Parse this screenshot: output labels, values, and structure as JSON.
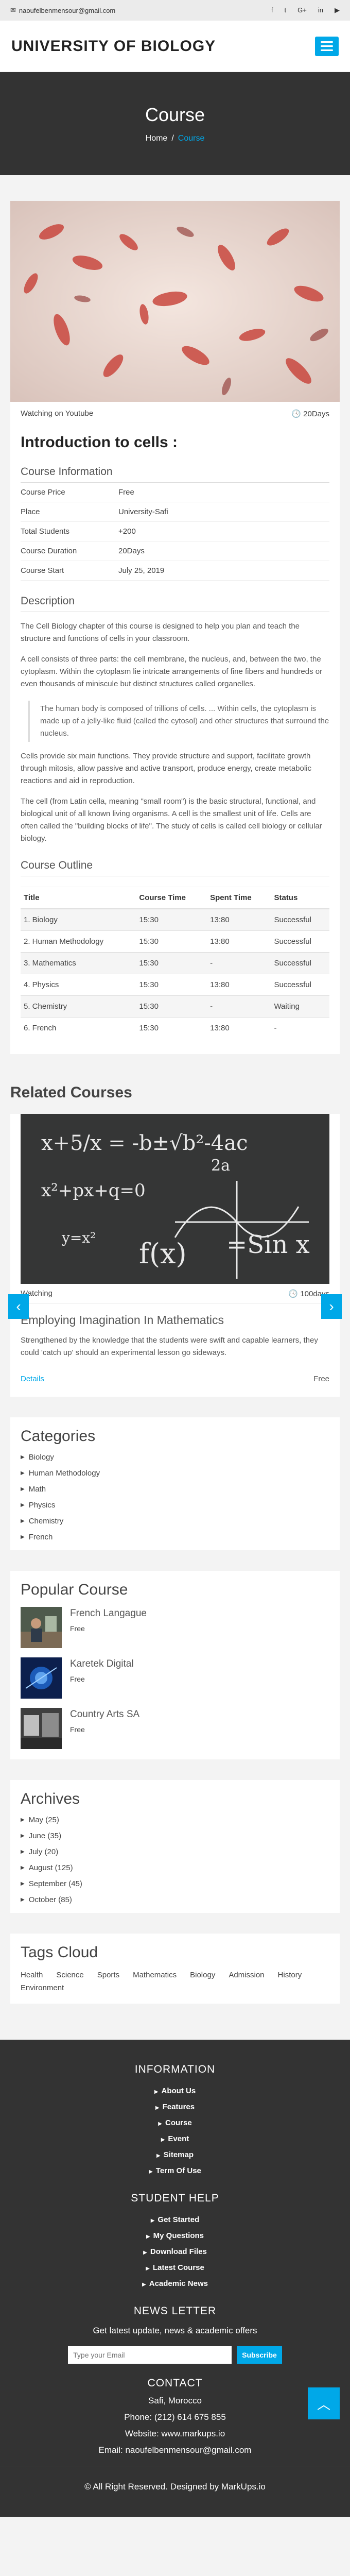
{
  "topbar": {
    "email": "naoufelbenmensour@gmail.com",
    "social": [
      "f",
      "t",
      "G+",
      "in",
      "▶"
    ]
  },
  "header": {
    "logo": "UNIVERSITY OF BIOLOGY"
  },
  "hero": {
    "title": "Course",
    "breadcrumb": [
      "Home",
      "/",
      "Course"
    ]
  },
  "course": {
    "watch_label": "Watching on Youtube",
    "duration_badge": "20Days",
    "title": "Introduction to cells :",
    "info_heading": "Course Information",
    "info": [
      {
        "k": "Course Price",
        "v": "Free"
      },
      {
        "k": "Place",
        "v": "University-Safi"
      },
      {
        "k": "Total Students",
        "v": "+200"
      },
      {
        "k": "Course Duration",
        "v": "20Days"
      },
      {
        "k": "Course Start",
        "v": "July 25, 2019"
      }
    ],
    "desc_heading": "Description",
    "desc_p1": "The Cell Biology chapter of this course is designed to help you plan and teach the structure and functions of cells in your classroom.",
    "desc_p2": "A cell consists of three parts: the cell membrane, the nucleus, and, between the two, the cytoplasm. Within the cytoplasm lie intricate arrangements of fine fibers and hundreds or even thousands of miniscule but distinct structures called organelles.",
    "quote": "The human body is composed of trillions of cells. ... Within cells, the cytoplasm is made up of a jelly-like fluid (called the cytosol) and other structures that surround the nucleus.",
    "desc_p3": "Cells provide six main functions. They provide structure and support, facilitate growth through mitosis, allow passive and active transport, produce energy, create metabolic reactions and aid in reproduction.",
    "desc_p4": "The cell (from Latin cella, meaning \"small room\") is the basic structural, functional, and biological unit of all known living organisms. A cell is the smallest unit of life. Cells are often called the \"building blocks of life\". The study of cells is called cell biology or cellular biology.",
    "outline_heading": "Course Outline",
    "outline_headers": [
      "Title",
      "Course Time",
      "Spent Time",
      "Status"
    ],
    "outline_rows": [
      [
        "1. Biology",
        "15:30",
        "13:80",
        "Successful"
      ],
      [
        "2. Human Methodology",
        "15:30",
        "13:80",
        "Successful"
      ],
      [
        "3. Mathematics",
        "15:30",
        "-",
        "Successful"
      ],
      [
        "4. Physics",
        "15:30",
        "13:80",
        "Successful"
      ],
      [
        "5. Chemistry",
        "15:30",
        "-",
        "Waiting"
      ],
      [
        "6. French",
        "15:30",
        "13:80",
        "-"
      ]
    ]
  },
  "related": {
    "heading": "Related Courses",
    "watch_label": "Watching",
    "days": "100days",
    "title": "Employing Imagination In Mathematics",
    "text": "Strengthened by the knowledge that the students were swift and capable learners, they could 'catch up' should an experimental lesson go sideways.",
    "details": "Details",
    "price": "Free",
    "board_formulas": [
      "x+5/x = -b±√b²-4ac",
      "2a",
      "x²+px+q=0",
      "f(x)",
      "=Sin x",
      "y=x²"
    ]
  },
  "categories": {
    "heading": "Categories",
    "items": [
      "Biology",
      "Human Methodology",
      "Math",
      "Physics",
      "Chemistry",
      "French"
    ]
  },
  "popular": {
    "heading": "Popular Course",
    "items": [
      {
        "name": "French Langague",
        "price": "Free"
      },
      {
        "name": "Karetek Digital",
        "price": "Free"
      },
      {
        "name": "Country Arts SA",
        "price": "Free"
      }
    ]
  },
  "archives": {
    "heading": "Archives",
    "items": [
      "May (25)",
      "June (35)",
      "July (20)",
      "August (125)",
      "September (45)",
      "October (85)"
    ]
  },
  "tags": {
    "heading": "Tags Cloud",
    "items": [
      "Health",
      "Science",
      "Sports",
      "Mathematics",
      "Biology",
      "Admission",
      "History",
      "Environment"
    ]
  },
  "footer": {
    "info_heading": "INFORMATION",
    "info_links": [
      "About Us",
      "Features",
      "Course",
      "Event",
      "Sitemap",
      "Term Of Use"
    ],
    "help_heading": "STUDENT HELP",
    "help_links": [
      "Get Started",
      "My Questions",
      "Download Files",
      "Latest Course",
      "Academic News"
    ],
    "news_heading": "NEWS LETTER",
    "news_text": "Get latest update, news & academic offers",
    "email_placeholder": "Type your Email",
    "subscribe": "Subscribe",
    "contact_heading": "CONTACT",
    "contact_lines": [
      "Safi, Morocco",
      "Phone: (212) 614 675 855",
      "Website: www.markups.io",
      "Email: naoufelbenmensour@gmail.com"
    ],
    "copyright": "© All Right Reserved. Designed by MarkUps.io"
  },
  "colors": {
    "accent": "#00a8e8",
    "dark": "#333333"
  }
}
